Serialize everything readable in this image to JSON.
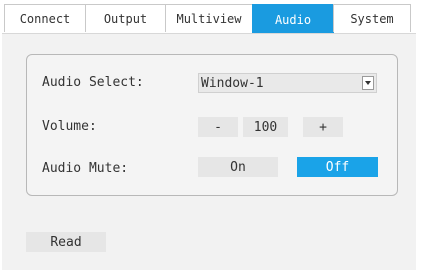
{
  "tabs": [
    {
      "label": "Connect"
    },
    {
      "label": "Output"
    },
    {
      "label": "Multiview"
    },
    {
      "label": "Audio",
      "active": true
    },
    {
      "label": "System"
    }
  ],
  "audio": {
    "select_label": "Audio Select:",
    "select_value": "Window-1",
    "volume_label": "Volume:",
    "volume_minus": "-",
    "volume_value": "100",
    "volume_plus": "+",
    "mute_label": "Audio Mute:",
    "mute_on": "On",
    "mute_off": "Off"
  },
  "read_button": "Read",
  "colors": {
    "accent": "#1a9be0",
    "panel": "#f2f2f2",
    "button": "#e6e6e6"
  }
}
